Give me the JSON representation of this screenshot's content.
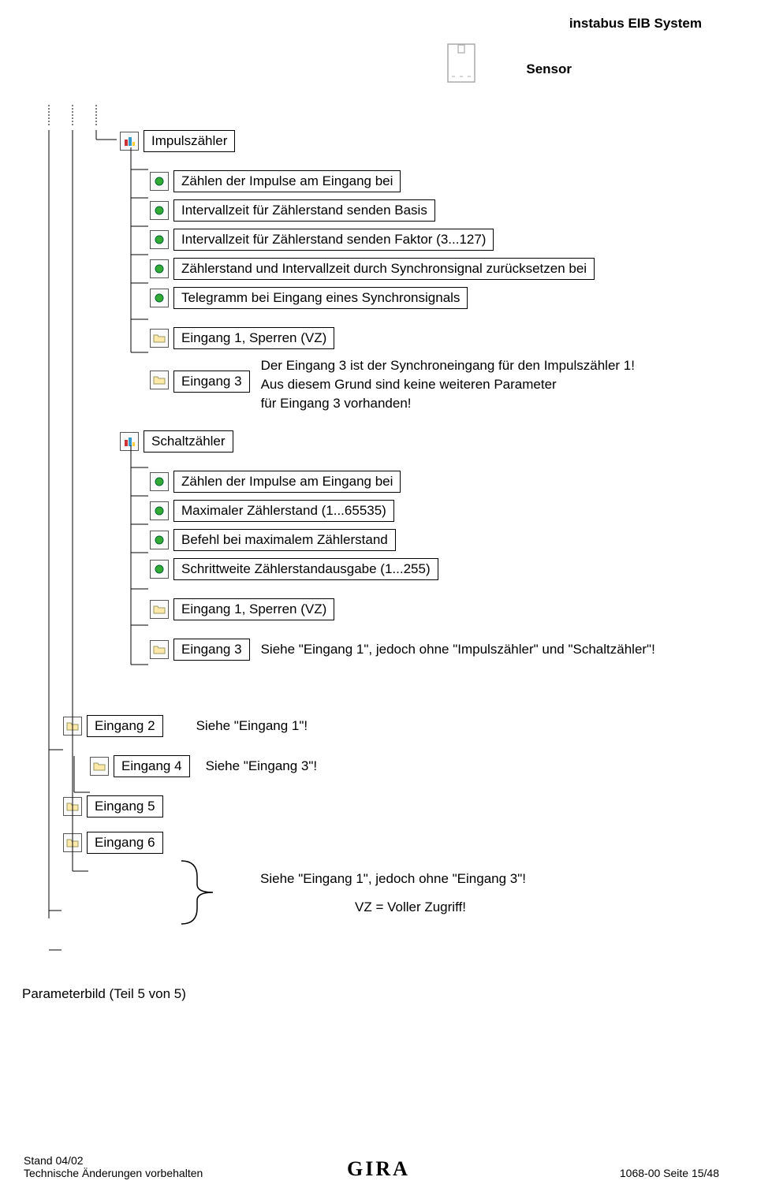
{
  "header": {
    "title": "instabus EIB System",
    "subtitle": "Sensor"
  },
  "tree": {
    "l1a": "Impulszähler",
    "l2a": "Zählen der Impulse am Eingang bei",
    "l2b": "Intervallzeit für Zählerstand senden Basis",
    "l2c": "Intervallzeit für Zählerstand senden Faktor (3...127)",
    "l2d": "Zählerstand und Intervallzeit durch Synchronsignal zurücksetzen bei",
    "l2e": "Telegramm bei Eingang eines Synchronsignals",
    "l2f": "Eingang 1, Sperren (VZ)",
    "l2g": "Eingang 3",
    "note1_line1": "Der Eingang 3 ist der Synchroneingang für den Impulszähler 1!",
    "note1_line2": "Aus diesem Grund sind keine weiteren Parameter",
    "note1_line3": "für Eingang 3 vorhanden!",
    "l1b": "Schaltzähler",
    "l2h": "Zählen der Impulse am Eingang bei",
    "l2i": "Maximaler Zählerstand (1...65535)",
    "l2j": "Befehl bei maximalem Zählerstand",
    "l2k": "Schrittweite Zählerstandausgabe (1...255)",
    "l2l": "Eingang 1, Sperren (VZ)",
    "l2m": "Eingang 3",
    "note2": "Siehe \"Eingang 1\", jedoch ohne \"Impulszähler\" und \"Schaltzähler\"!",
    "e2": "Eingang 2",
    "e2note": "Siehe \"Eingang 1\"!",
    "e4": "Eingang 4",
    "e4note": "Siehe \"Eingang 3\"!",
    "e5": "Eingang 5",
    "e6": "Eingang 6",
    "note3_line1": "Siehe \"Eingang 1\", jedoch ohne \"Eingang 3\"!",
    "note3_line2": "VZ = Voller Zugriff!",
    "param_caption": "Parameterbild (Teil 5 von 5)"
  },
  "footer": {
    "left_line1": "Stand 04/02",
    "left_line2": "Technische Änderungen vorbehalten",
    "right": "1068-00 Seite 15/48",
    "logo": "GIRA"
  }
}
